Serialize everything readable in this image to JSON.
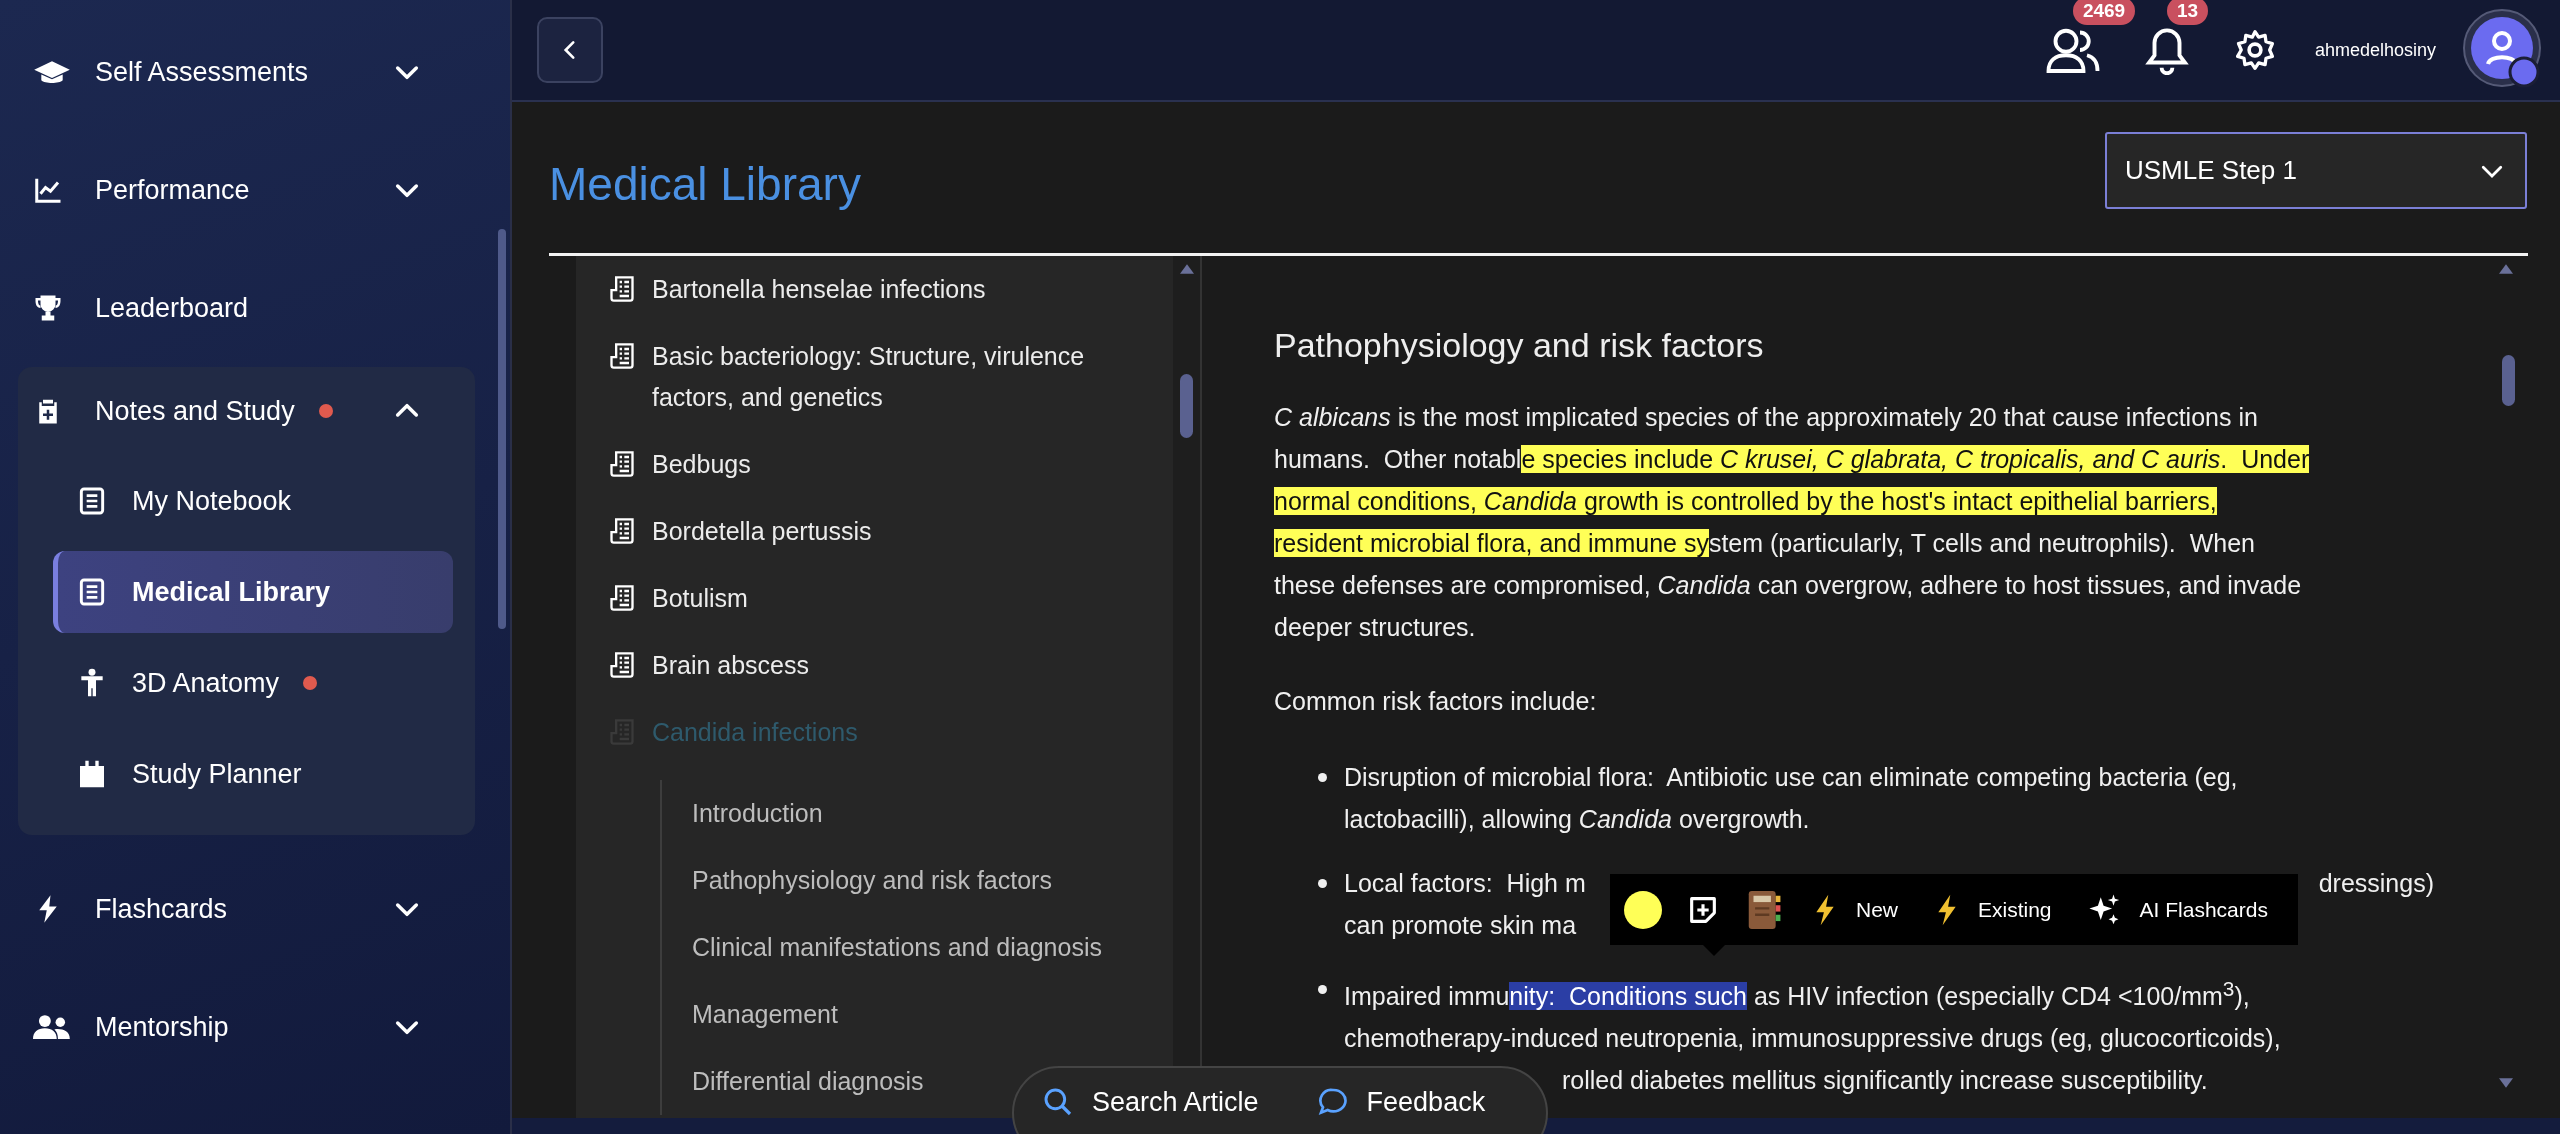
{
  "sidebar": {
    "items": [
      {
        "label": "Self Assessments",
        "expanded": false,
        "dot": false
      },
      {
        "label": "Performance",
        "expanded": false,
        "dot": false
      },
      {
        "label": "Leaderboard",
        "dot": false
      },
      {
        "label": "Notes and Study",
        "expanded": true,
        "dot": true,
        "children": [
          {
            "label": "My Notebook",
            "selected": false,
            "dot": false
          },
          {
            "label": "Medical Library",
            "selected": true,
            "dot": false
          },
          {
            "label": "3D Anatomy",
            "selected": false,
            "dot": true
          },
          {
            "label": "Study Planner",
            "selected": false,
            "dot": false
          }
        ]
      },
      {
        "label": "Flashcards",
        "expanded": false,
        "dot": false
      },
      {
        "label": "Mentorship",
        "expanded": false,
        "dot": false
      }
    ]
  },
  "header": {
    "badges": [
      {
        "count": "2469"
      },
      {
        "count": "13"
      }
    ],
    "username": "ahmedelhosiny"
  },
  "page": {
    "title": "Medical Library",
    "exam_select": {
      "value": "USMLE Step 1"
    }
  },
  "tree": {
    "items": [
      {
        "label": "Bartonella henselae infections",
        "selected": false
      },
      {
        "label": "Basic bacteriology: Structure, virulence factors, and genetics",
        "selected": false
      },
      {
        "label": "Bedbugs",
        "selected": false
      },
      {
        "label": "Bordetella pertussis",
        "selected": false
      },
      {
        "label": "Botulism",
        "selected": false
      },
      {
        "label": "Brain abscess",
        "selected": false
      },
      {
        "label": "Candida infections",
        "selected": true,
        "children": [
          {
            "label": "Introduction"
          },
          {
            "label": "Pathophysiology and risk factors"
          },
          {
            "label": "Clinical manifestations and diagnosis"
          },
          {
            "label": "Management"
          },
          {
            "label": "Differential diagnosis"
          }
        ]
      }
    ]
  },
  "article": {
    "heading": "Pathophysiology and risk factors",
    "paragraph": [
      {
        "segments": [
          {
            "text": "*C albicans* is the most implicated species of the approximately 20 that cause infections in",
            "kind": "plain"
          }
        ]
      },
      {
        "segments": [
          {
            "text": "humans.  Other notabl",
            "kind": "plain"
          },
          {
            "text": "e species include *C krusei, C glabrata, C tropicalis, and C auris*.  Under",
            "kind": "highlight"
          }
        ]
      },
      {
        "segments": [
          {
            "text": "normal conditions, *Candida* growth is controlled by the host's intact epithelial barriers,",
            "kind": "highlight"
          }
        ]
      },
      {
        "segments": [
          {
            "text": "resident microbial flora, and immune sy",
            "kind": "highlight"
          },
          {
            "text": "stem (particularly, T cells and neutrophils).  When",
            "kind": "plain"
          }
        ]
      },
      {
        "segments": [
          {
            "text": "these defenses are compromised, *Candida* can overgrow, adhere to host tissues, and invade",
            "kind": "plain"
          }
        ]
      },
      {
        "segments": [
          {
            "text": "deeper structures.",
            "kind": "plain"
          }
        ]
      }
    ],
    "list_intro": "Common risk factors include:",
    "bullets": [
      {
        "kind": "whole",
        "lines": [
          {
            "segments": [
              {
                "text": "Disruption of microbial flora:  Antibiotic use can eliminate competing bacteria (eg,",
                "kind": "plain"
              }
            ]
          },
          {
            "segments": [
              {
                "text": "lactobacilli), allowing *Candida* overgrowth.",
                "kind": "plain"
              }
            ]
          }
        ]
      },
      {
        "kind": "split",
        "lines": [
          {
            "kind": "full",
            "segments": [
              {
                "text": "Local factors:  High m",
                "kind": "plain"
              }
            ],
            "right": "dressings)"
          },
          {
            "kind": "full",
            "segments": [
              {
                "text": "can promote skin ma",
                "kind": "plain"
              }
            ]
          }
        ]
      },
      {
        "kind": "split",
        "lines": [
          {
            "kind": "full",
            "segments": [
              {
                "text": "Impaired immu",
                "kind": "plain"
              },
              {
                "text": "nity:  Conditions such",
                "kind": "selection"
              },
              {
                "text": " as HIV infection (especially CD4 <100/mm$^{3}$),",
                "kind": "plain"
              }
            ]
          },
          {
            "kind": "full",
            "segments": [
              {
                "text": "chemotherapy-induced neutropenia, immunosuppressive drugs (eg, glucocorticoids),",
                "kind": "plain"
              }
            ]
          },
          {
            "kind": "after_overlay",
            "segments": [
              {
                "text": "rolled diabetes mellitus significantly increase susceptibility.",
                "kind": "plain"
              }
            ]
          }
        ]
      }
    ]
  },
  "selection_toolbar": {
    "actions": [
      {
        "kind": "color",
        "color": "#ffff57"
      },
      {
        "kind": "note"
      },
      {
        "kind": "notebook"
      },
      {
        "kind": "flashcard",
        "label": "New"
      },
      {
        "kind": "flashcard",
        "label": "Existing"
      },
      {
        "kind": "ai",
        "label": "AI Flashcards"
      }
    ]
  },
  "bottom_pill": {
    "buttons": [
      {
        "kind": "search",
        "label": "Search Article"
      },
      {
        "kind": "feedback",
        "label": "Feedback"
      }
    ]
  }
}
